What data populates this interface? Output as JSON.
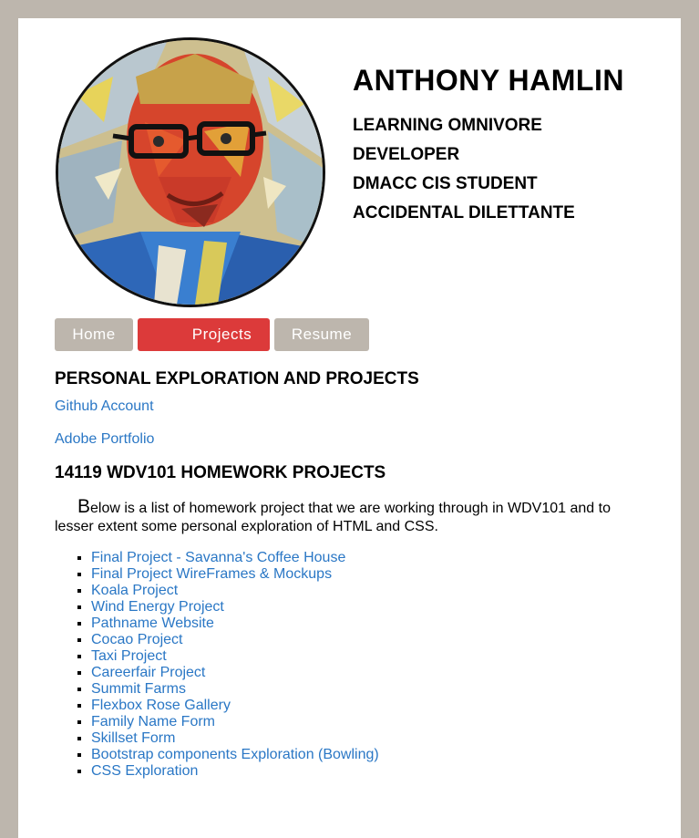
{
  "header": {
    "name": "ANTHONY HAMLIN",
    "roles": [
      "LEARNING OMNIVORE",
      "DEVELOPER",
      "DMACC CIS STUDENT",
      "ACCIDENTAL DILETTANTE"
    ]
  },
  "nav": {
    "home": "Home",
    "projects": "Projects",
    "resume": "Resume",
    "active": "Projects",
    "active_color": "#dc3a3a",
    "inactive_color": "#bdb6ad"
  },
  "personal": {
    "heading": "PERSONAL EXPLORATION AND PROJECTS",
    "github": "Github Account",
    "adobe": "Adobe Portfolio"
  },
  "homework": {
    "heading": "14119 WDV101 HOMEWORK PROJECTS",
    "intro_cap": "B",
    "intro_rest": "elow is a list of homework project that we are working through in WDV101 and to lesser extent some personal exploration of HTML and CSS.",
    "projects": [
      "Final Project - Savanna's Coffee House",
      "Final Project WireFrames & Mockups",
      "Koala Project",
      "Wind Energy Project",
      "Pathname Website",
      "Cocao Project",
      "Taxi Project",
      "Careerfair Project",
      "Summit Farms",
      "Flexbox Rose Gallery",
      "Family Name Form",
      "Skillset Form",
      "Bootstrap components Exploration (Bowling)",
      "CSS Exploration"
    ]
  },
  "colors": {
    "background": "#bdb6ad",
    "link": "#2a77c5"
  }
}
